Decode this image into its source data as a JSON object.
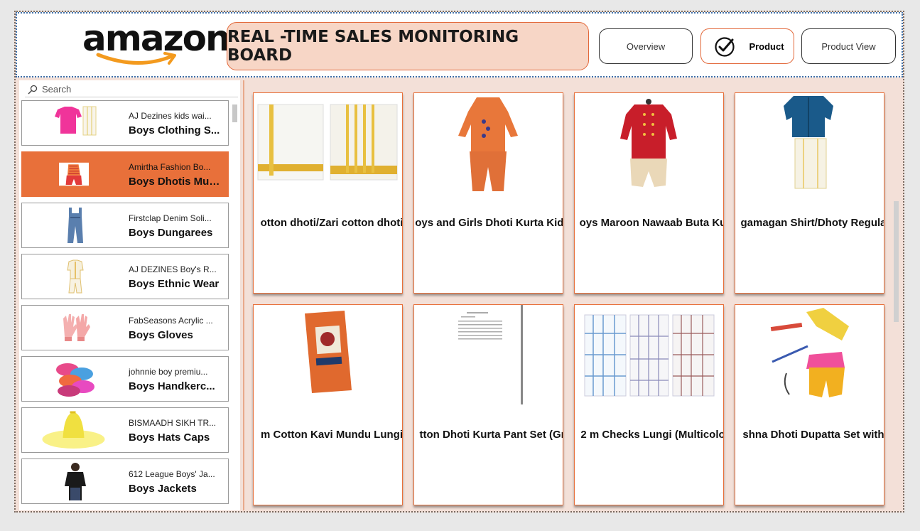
{
  "header": {
    "logo_text": "amazon",
    "title": "REAL -TIME SALES MONITORING BOARD",
    "nav": [
      {
        "label": "Overview",
        "active": false
      },
      {
        "label": "Product",
        "active": true
      },
      {
        "label": "Product View",
        "active": false
      }
    ]
  },
  "search": {
    "placeholder": "Search"
  },
  "sidebar": {
    "items": [
      {
        "sub": "AJ Dezines kids wai...",
        "category": "Boys Clothing S...",
        "selected": false
      },
      {
        "sub": "Amirtha Fashion Bo...",
        "category": "Boys Dhotis Mundus",
        "selected": true
      },
      {
        "sub": "Firstclap Denim Soli...",
        "category": "Boys Dungarees",
        "selected": false
      },
      {
        "sub": "AJ DEZINES Boy's R...",
        "category": "Boys Ethnic Wear",
        "selected": false
      },
      {
        "sub": "FabSeasons Acrylic ...",
        "category": "Boys Gloves",
        "selected": false
      },
      {
        "sub": "johnnie boy premiu...",
        "category": "Boys Handkerc...",
        "selected": false
      },
      {
        "sub": "BISMAADH SIKH TR...",
        "category": "Boys Hats Caps",
        "selected": false
      },
      {
        "sub": "612 League Boys' Ja...",
        "category": "Boys Jackets",
        "selected": false
      }
    ]
  },
  "products": [
    {
      "label": "otton dhoti/Zari cotton dhoti"
    },
    {
      "label": "oys and Girls Dhoti Kurta Kids"
    },
    {
      "label": "oys Maroon Nawaab Buta Ku"
    },
    {
      "label": "gamagan Shirt/Dhoty Regula"
    },
    {
      "label": "m Cotton Kavi Mundu Lungi"
    },
    {
      "label": "tton Dhoti Kurta Pant Set (Gr"
    },
    {
      "label": "2 m Checks Lungi (Multicolo"
    },
    {
      "label": "shna Dhoti Dupatta Set with"
    }
  ],
  "colors": {
    "accent": "#e8703a",
    "title_bg": "#f7d6c6",
    "panel_bg": "#f3e0d8"
  }
}
